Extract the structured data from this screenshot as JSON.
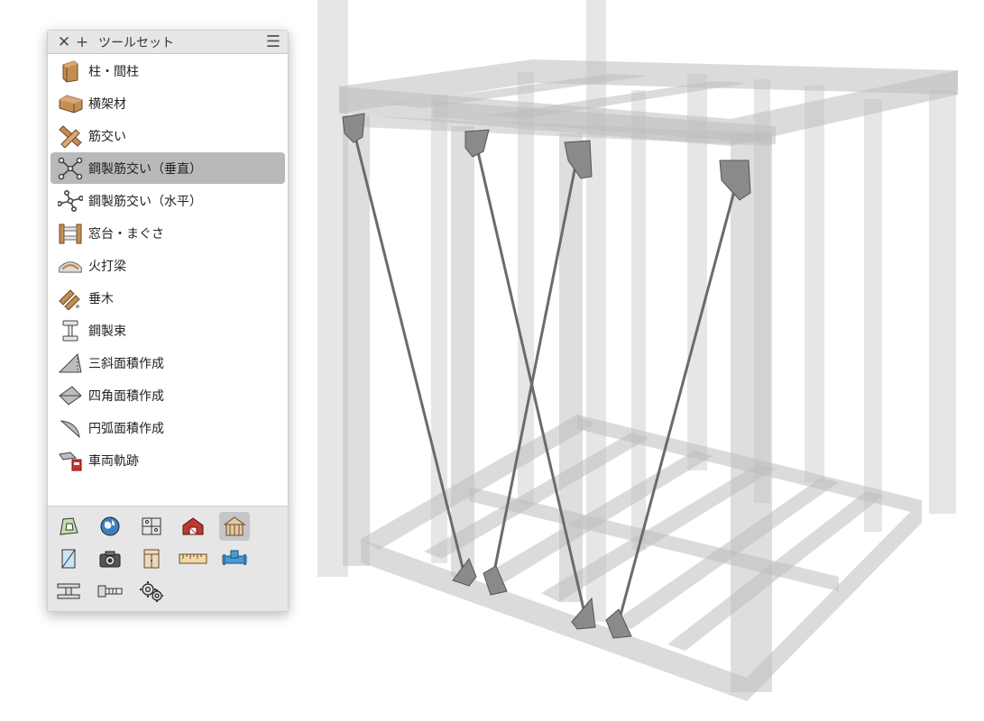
{
  "toolset": {
    "title": "ツールセット",
    "close_glyph": "✕",
    "add_glyph": "+",
    "menu_glyph": "☰",
    "items": [
      {
        "label": "柱・間柱",
        "icon": "post-icon",
        "selected": false
      },
      {
        "label": "横架材",
        "icon": "beam-icon",
        "selected": false
      },
      {
        "label": "筋交い",
        "icon": "brace-icon",
        "selected": false
      },
      {
        "label": "鋼製筋交い（垂直）",
        "icon": "steel-brace-vertical-icon",
        "selected": true
      },
      {
        "label": "鋼製筋交い（水平）",
        "icon": "steel-brace-horizontal-icon",
        "selected": false
      },
      {
        "label": "窓台・まぐさ",
        "icon": "window-sill-icon",
        "selected": false
      },
      {
        "label": "火打梁",
        "icon": "angle-brace-icon",
        "selected": false
      },
      {
        "label": "垂木",
        "icon": "rafter-icon",
        "selected": false
      },
      {
        "label": "鋼製束",
        "icon": "steel-post-icon",
        "selected": false
      },
      {
        "label": "三斜面積作成",
        "icon": "triangle-area-icon",
        "selected": false
      },
      {
        "label": "四角面積作成",
        "icon": "quad-area-icon",
        "selected": false
      },
      {
        "label": "円弧面積作成",
        "icon": "arc-area-icon",
        "selected": false
      },
      {
        "label": "車両軌跡",
        "icon": "vehicle-path-icon",
        "selected": false
      }
    ],
    "palette_rows": [
      [
        "site-plan-icon",
        "globe-icon",
        "floor-plan-icon",
        "barn-icon",
        "wood-frame-house-icon"
      ],
      [
        "mirror-icon",
        "camera-icon",
        "cabinet-icon",
        "ruler-icon",
        "pipe-icon"
      ],
      [
        "steel-beam-icon",
        "bolt-icon",
        "gears-icon"
      ]
    ],
    "palette_selected": "wood-frame-house-icon"
  },
  "colors": {
    "selection": "#b9b9b9",
    "panel_chrome": "#e6e6e6",
    "frame_member": "#c4c4c4",
    "steel_rod": "#6e6e6e",
    "wood": "#c48d52"
  }
}
